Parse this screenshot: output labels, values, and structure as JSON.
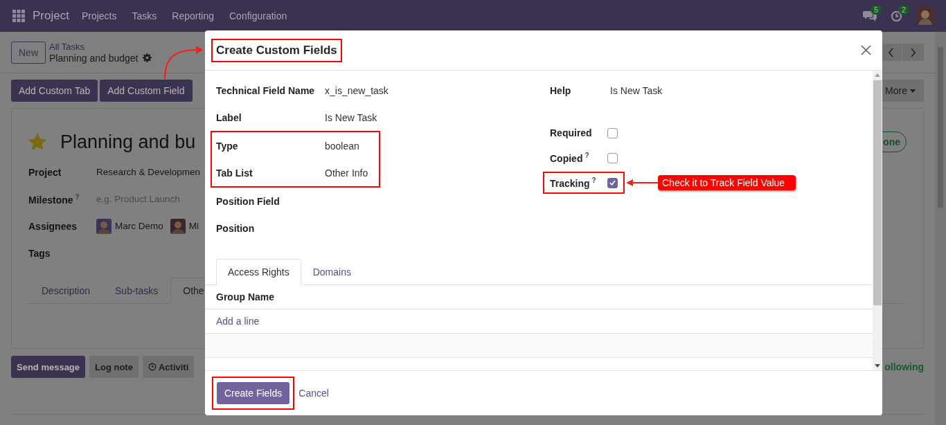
{
  "navbar": {
    "app_name": "Project",
    "menu": [
      "Projects",
      "Tasks",
      "Reporting",
      "Configuration"
    ],
    "messages_badge": "5",
    "activities_badge": "2"
  },
  "control_panel": {
    "new_button": "New",
    "breadcrumb_parent": "All Tasks",
    "breadcrumb_current": "Planning and budget"
  },
  "action_buttons": [
    "Add Custom Tab",
    "Add Custom Field"
  ],
  "more_button": "More",
  "task_form": {
    "starred": true,
    "title": "Planning and bu",
    "status_button": "one",
    "fields": [
      {
        "label": "Project",
        "kind": "text",
        "value": "Research & Developmen"
      },
      {
        "label": "Milestone",
        "help_mark": "?",
        "kind": "placeholder",
        "placeholder": "e.g. Product Launch"
      },
      {
        "label": "Assignees",
        "kind": "avatars",
        "assignees": [
          "Marc Demo",
          "Mi"
        ]
      },
      {
        "label": "Tags",
        "kind": "empty"
      }
    ],
    "tabs": [
      {
        "label": "Description",
        "selected": false
      },
      {
        "label": "Sub-tasks",
        "selected": false
      },
      {
        "label": "Othe",
        "selected": true
      }
    ]
  },
  "chatter": {
    "buttons": [
      {
        "label": "Send message",
        "kind": "primary"
      },
      {
        "label": "Log note",
        "kind": "secondary"
      },
      {
        "label": "Activiti",
        "kind": "activity"
      }
    ],
    "following": "ollowing"
  },
  "dialog": {
    "title": "Create Custom Fields",
    "title_highlighted": true,
    "left_groups": [
      {
        "highlighted": false,
        "fields": [
          {
            "label": "Technical Field Name",
            "value": "x_is_new_task"
          },
          {
            "label": "Label",
            "value": "Is New Task"
          }
        ]
      },
      {
        "highlighted": true,
        "fields": [
          {
            "label": "Type",
            "value": "boolean"
          },
          {
            "label": "Tab List",
            "value": "Other Info"
          }
        ]
      },
      {
        "highlighted": false,
        "fields": [
          {
            "label": "Position Field"
          },
          {
            "label": "Position"
          }
        ]
      }
    ],
    "help": {
      "label": "Help",
      "value": "Is New Task"
    },
    "options": [
      {
        "label": "Required",
        "checked": false,
        "highlighted": false
      },
      {
        "label": "Copied",
        "help_mark": "?",
        "checked": false,
        "highlighted": false
      },
      {
        "label": "Tracking",
        "help_mark": "?",
        "checked": true,
        "highlighted": true,
        "callout": "Check it to Track Field Value"
      }
    ],
    "tabs": [
      {
        "label": "Access Rights",
        "selected": true
      },
      {
        "label": "Domains",
        "selected": false
      }
    ],
    "table": {
      "columns": [
        "Group Name"
      ],
      "add_line": "Add a line"
    },
    "footer_buttons": [
      {
        "label": "Create Fields",
        "kind": "primary",
        "highlighted": true
      },
      {
        "label": "Cancel",
        "kind": "link",
        "highlighted": false
      }
    ]
  }
}
